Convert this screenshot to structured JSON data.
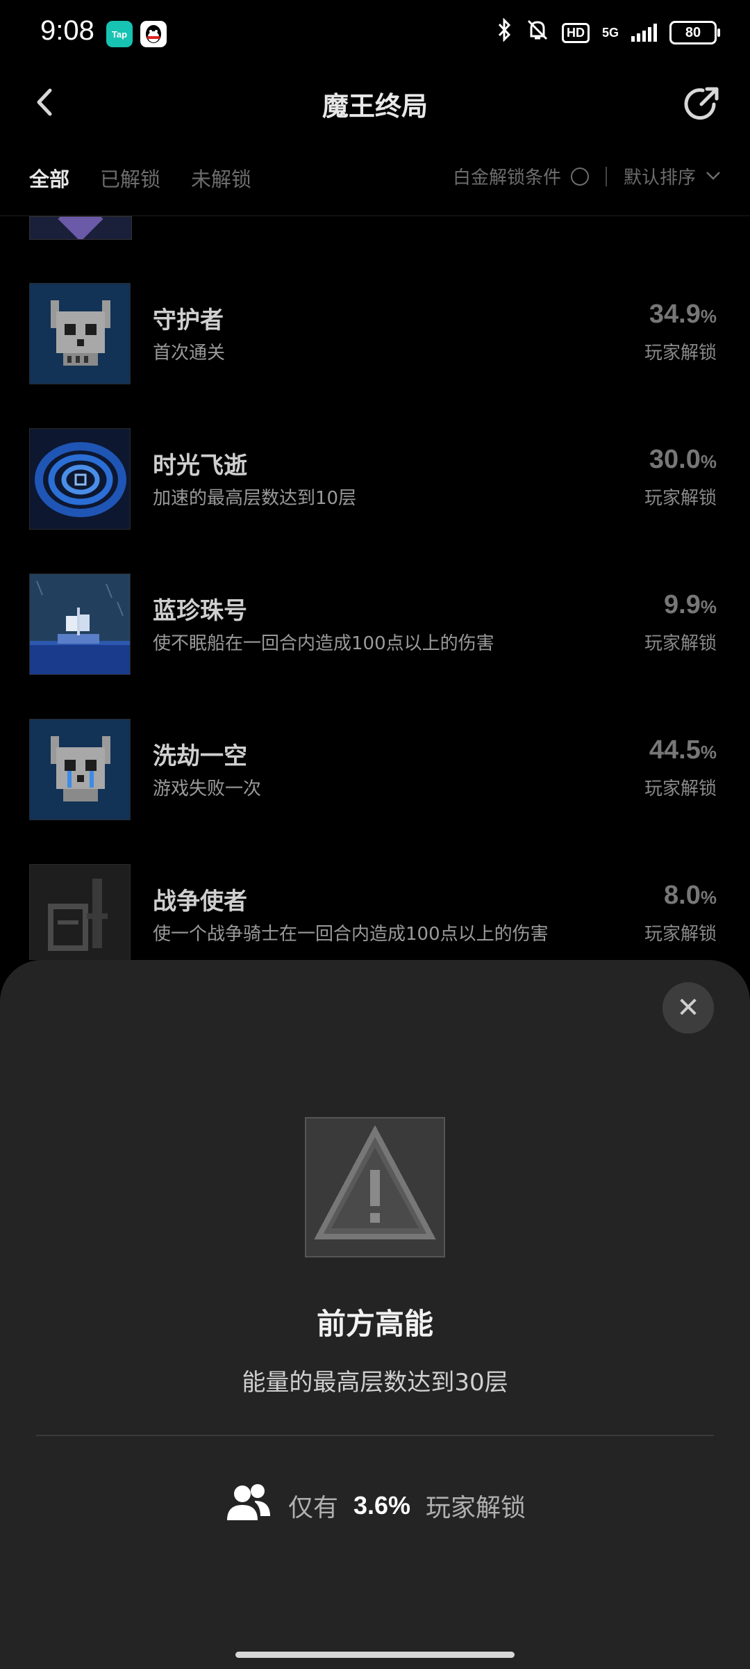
{
  "status_bar": {
    "time": "9:08",
    "tap_badge": "Tap",
    "network": "5G",
    "battery": "80",
    "hd": "HD"
  },
  "header": {
    "title": "魔王终局"
  },
  "tabs": [
    {
      "label": "全部",
      "active": true
    },
    {
      "label": "已解锁",
      "active": false
    },
    {
      "label": "未解锁",
      "active": false
    }
  ],
  "filter": {
    "platinum_label": "白金解锁条件",
    "sort_label": "默认排序"
  },
  "achievements": [
    {
      "name": "守护者",
      "desc": "首次通关",
      "pct": "34.9",
      "pct_unit": "%",
      "pct_label": "玩家解锁",
      "icon": "skull-icon"
    },
    {
      "name": "时光飞逝",
      "desc": "加速的最高层数达到10层",
      "pct": "30.0",
      "pct_unit": "%",
      "pct_label": "玩家解锁",
      "icon": "vortex-icon"
    },
    {
      "name": "蓝珍珠号",
      "desc": "使不眠船在一回合内造成100点以上的伤害",
      "pct": "9.9",
      "pct_unit": "%",
      "pct_label": "玩家解锁",
      "icon": "ship-icon"
    },
    {
      "name": "洗劫一空",
      "desc": "游戏失败一次",
      "pct": "44.5",
      "pct_unit": "%",
      "pct_label": "玩家解锁",
      "icon": "crying-skull-icon"
    },
    {
      "name": "战争使者",
      "desc": "使一个战争骑士在一回合内造成100点以上的伤害",
      "pct": "8.0",
      "pct_unit": "%",
      "pct_label": "玩家解锁",
      "icon": "knight-icon"
    }
  ],
  "detail": {
    "title": "前方高能",
    "desc": "能量的最高层数达到30层",
    "stat_prefix": "仅有",
    "stat_value": "3.6%",
    "stat_suffix": "玩家解锁",
    "close_symbol": "✕",
    "icon": "warning-icon"
  }
}
